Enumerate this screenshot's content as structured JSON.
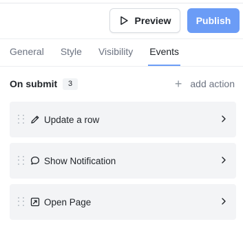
{
  "header": {
    "preview_label": "Preview",
    "publish_label": "Publish"
  },
  "tabs": [
    {
      "label": "General",
      "active": false
    },
    {
      "label": "Style",
      "active": false
    },
    {
      "label": "Visibility",
      "active": false
    },
    {
      "label": "Events",
      "active": true
    }
  ],
  "section": {
    "title": "On submit",
    "count": "3",
    "add_action_label": "add action"
  },
  "actions": [
    {
      "label": "Update a row",
      "icon": "pencil-icon"
    },
    {
      "label": "Show Notification",
      "icon": "chat-bubble-icon"
    },
    {
      "label": "Open Page",
      "icon": "page-link-icon"
    }
  ],
  "colors": {
    "accent": "#6b9cf6",
    "item_bg": "#f3f4f6"
  }
}
